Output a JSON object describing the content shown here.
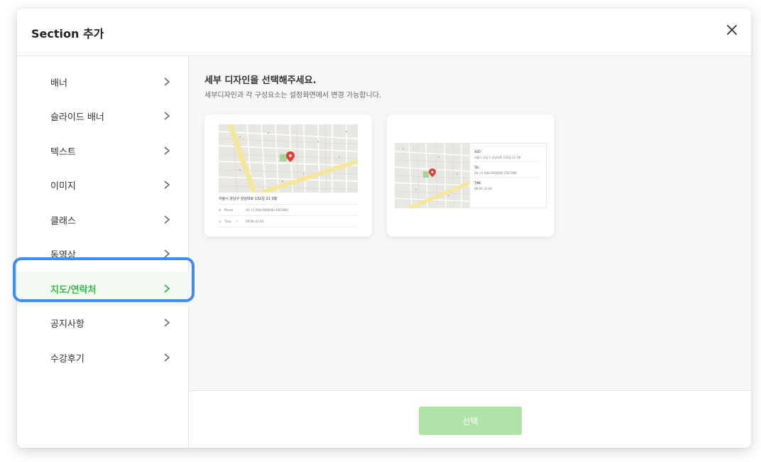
{
  "modal": {
    "title": "Section 추가",
    "close_icon": "close-icon"
  },
  "sidebar": {
    "items": [
      {
        "label": "배너",
        "active": false
      },
      {
        "label": "슬라이드 배너",
        "active": false
      },
      {
        "label": "텍스트",
        "active": false
      },
      {
        "label": "이미지",
        "active": false
      },
      {
        "label": "클래스",
        "active": false
      },
      {
        "label": "동영상",
        "active": false
      },
      {
        "label": "지도/연락처",
        "active": true
      },
      {
        "label": "공지사항",
        "active": false
      },
      {
        "label": "수강후기",
        "active": false
      }
    ]
  },
  "content": {
    "title": "세부 디자인을 선택해주세요.",
    "subtitle": "세부디자인과 각 구성요소는 설정화면에서 변경 가능합니다.",
    "cards": [
      {
        "address": "서울시 강남구 강남대로 132길 21 3층",
        "phone_label": "Phone",
        "phone_value": "US +1 000-0000000 4567890",
        "time_label": "Time",
        "time_sep": "—",
        "time_value": "09:00–22:00"
      },
      {
        "addr_label": "ADD",
        "addr_value": "서울시 강남구 강남대로 132길 21 3층",
        "tel_label": "TEL",
        "tel_value": "US +1 000-0000000 4567890",
        "time_label": "TIME",
        "time_value": "09:00–22:00"
      }
    ]
  },
  "footer": {
    "select_label": "선택"
  },
  "colors": {
    "accent_green": "#39b54a",
    "button_disabled_green": "#b0e3a8",
    "highlight_blue": "#3e8ef0"
  }
}
